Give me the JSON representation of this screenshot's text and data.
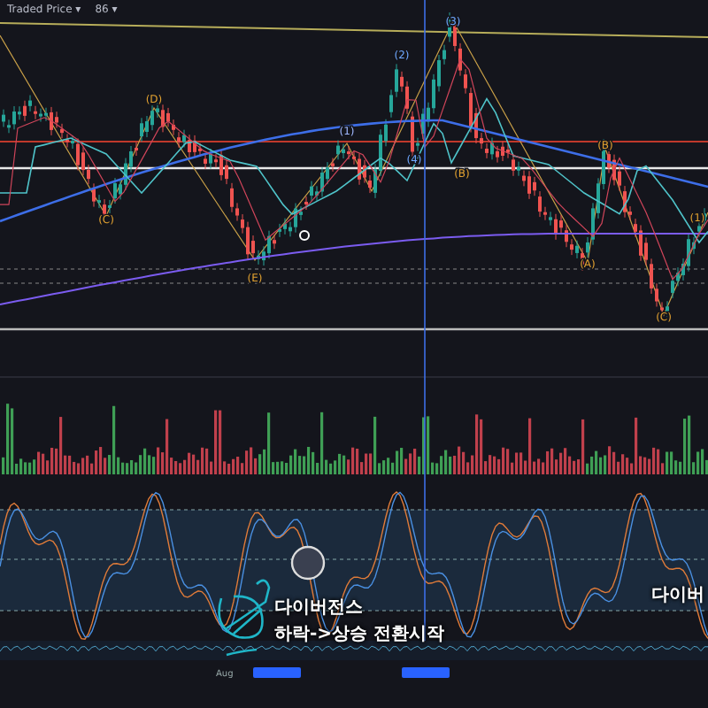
{
  "legend": {
    "series": "Traded Price ▾",
    "interval": "86 ▾"
  },
  "wave_labels": [
    {
      "text": "(D)",
      "color": "#e0a030"
    },
    {
      "text": "(C)",
      "color": "#e0a030"
    },
    {
      "text": "(E)",
      "color": "#e0a030"
    },
    {
      "text": "(1)",
      "color": "#9fb8ff"
    },
    {
      "text": "(2)",
      "color": "#6fa8ff"
    },
    {
      "text": "(3)",
      "color": "#6fa8ff"
    },
    {
      "text": "(4)",
      "color": "#6fa8ff"
    },
    {
      "text": "(B)",
      "color": "#e0a030"
    },
    {
      "text": "(A)",
      "color": "#e0a030"
    },
    {
      "text": "(B)",
      "color": "#e0a030"
    },
    {
      "text": "(C)",
      "color": "#e0a030"
    },
    {
      "text": "(1)",
      "color": "#e0a030"
    }
  ],
  "annotations": [
    {
      "text": "다이버전스"
    },
    {
      "text": "하락->상승 전환시작"
    },
    {
      "text": "다이버"
    }
  ],
  "time_axis": [
    "Aug"
  ]
}
